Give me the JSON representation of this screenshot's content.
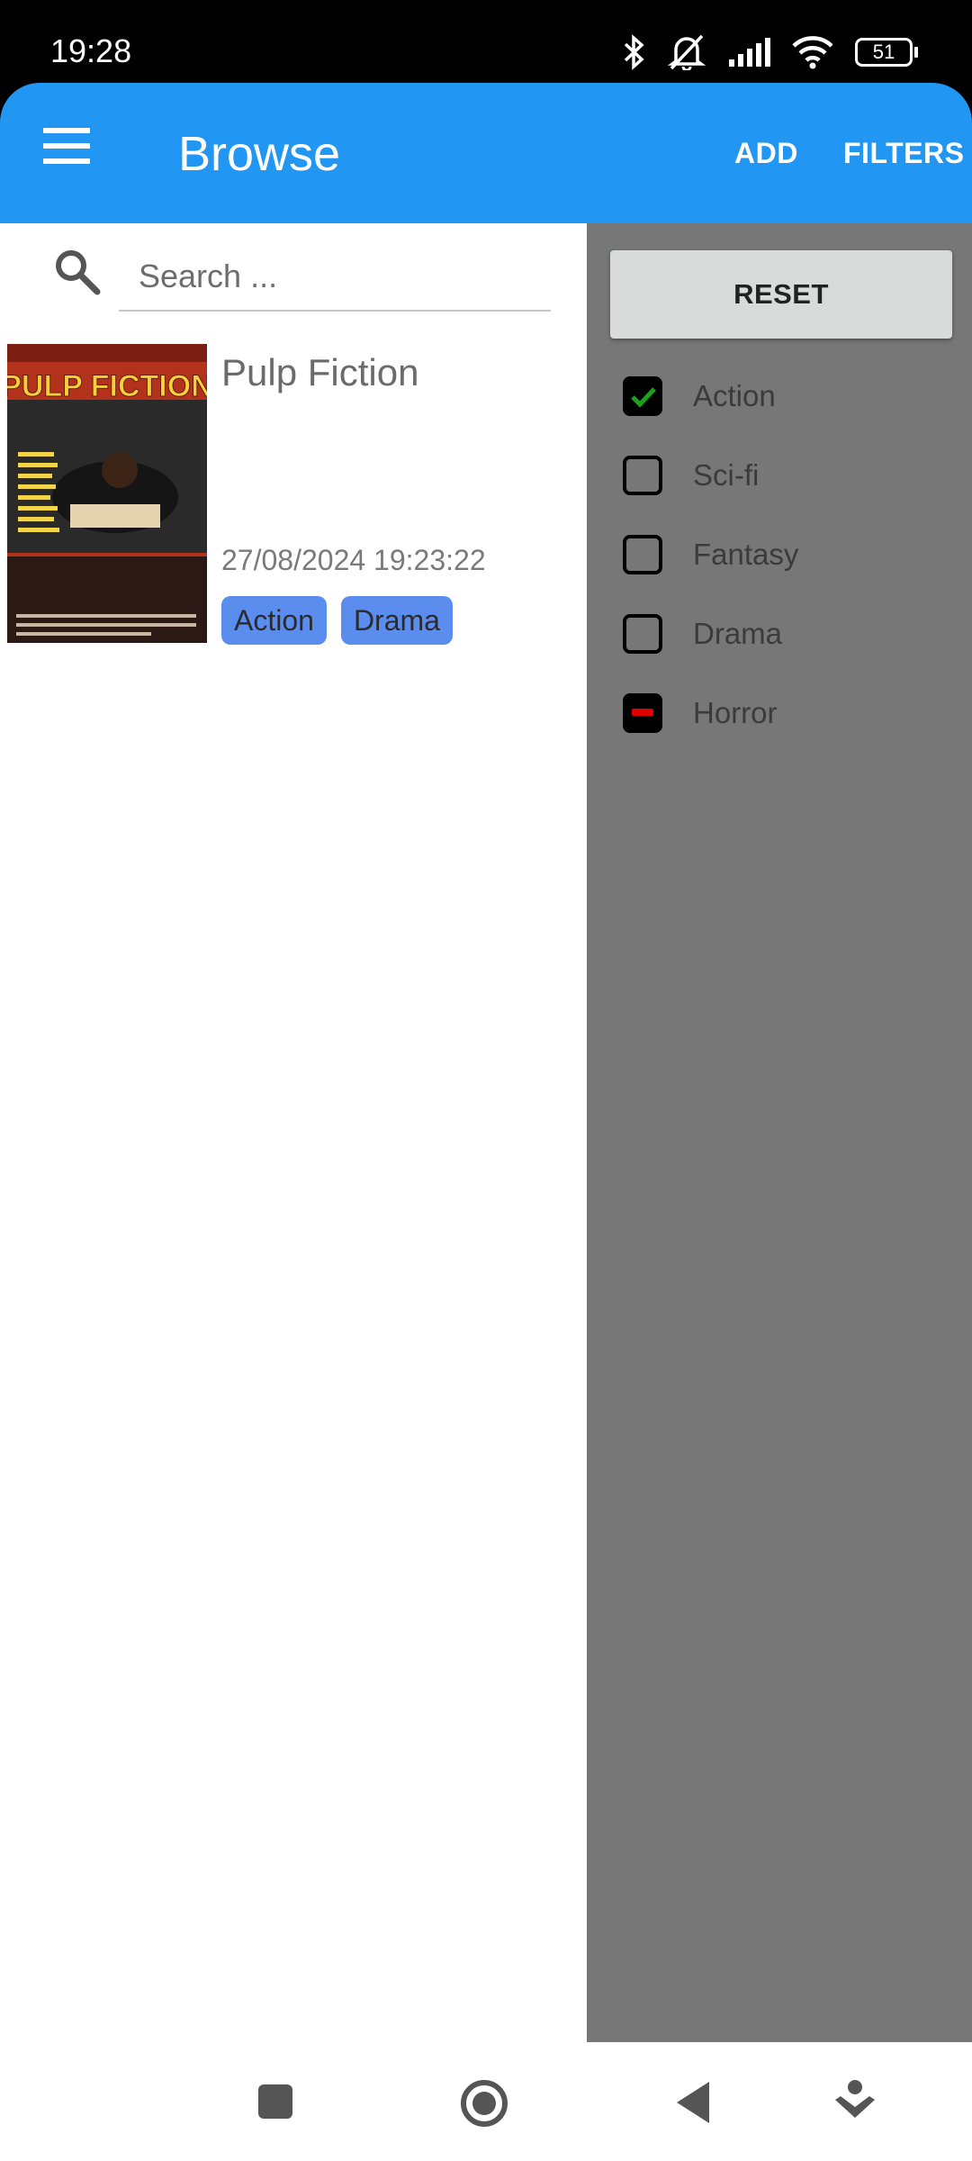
{
  "status_bar": {
    "time": "19:28",
    "battery": "51",
    "icons": [
      "bluetooth-icon",
      "silent-bell-icon",
      "signal-icon",
      "wifi-icon",
      "battery-icon"
    ]
  },
  "app_bar": {
    "title": "Browse",
    "add_label": "ADD",
    "filters_label": "FILTERS",
    "background": "#2196F3"
  },
  "search": {
    "placeholder": "Search ...",
    "value": ""
  },
  "movies": [
    {
      "title": "Pulp Fiction",
      "date": "27/08/2024 19:23:22",
      "poster_text": "PULP FICTION",
      "tags": [
        "Action",
        "Drama"
      ]
    }
  ],
  "filters": {
    "reset_label": "RESET",
    "items": [
      {
        "label": "Action",
        "state": "checked"
      },
      {
        "label": "Sci-fi",
        "state": "unchecked"
      },
      {
        "label": "Fantasy",
        "state": "unchecked"
      },
      {
        "label": "Drama",
        "state": "unchecked"
      },
      {
        "label": "Horror",
        "state": "excluded"
      }
    ]
  },
  "nav_bar": {
    "buttons": [
      "recents-icon",
      "home-icon",
      "back-icon",
      "assistant-icon"
    ]
  }
}
